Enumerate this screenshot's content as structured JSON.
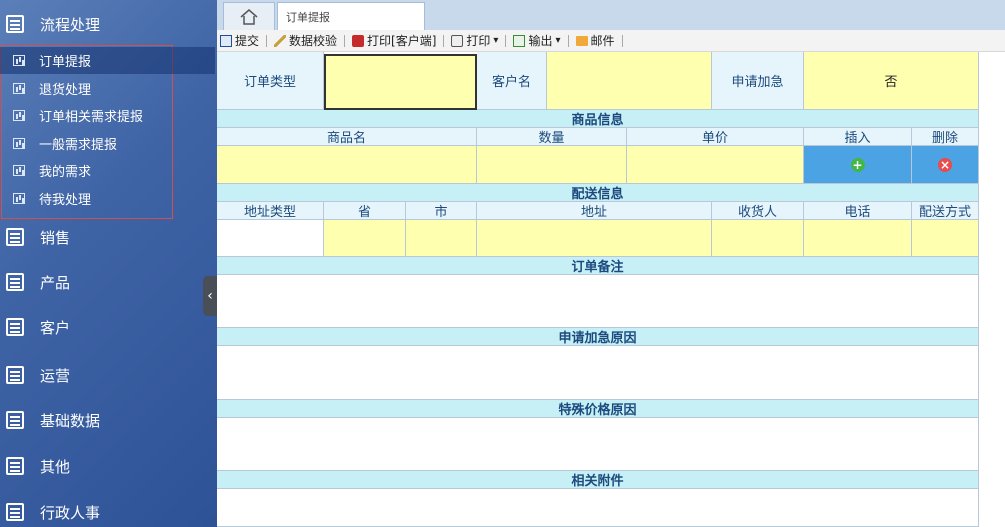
{
  "sidebar": {
    "categories": [
      {
        "label": "流程处理"
      },
      {
        "label": "销售"
      },
      {
        "label": "产品"
      },
      {
        "label": "客户"
      },
      {
        "label": "运营"
      },
      {
        "label": "基础数据"
      },
      {
        "label": "其他"
      },
      {
        "label": "行政人事"
      }
    ],
    "submenu": [
      {
        "label": "订单提报"
      },
      {
        "label": "退货处理"
      },
      {
        "label": "订单相关需求提报"
      },
      {
        "label": "一般需求提报"
      },
      {
        "label": "我的需求"
      },
      {
        "label": "待我处理"
      }
    ],
    "collapse_glyph": "‹"
  },
  "tabs": {
    "home_icon": "home-icon",
    "active_tab": "订单提报"
  },
  "toolbar": {
    "submit": "提交",
    "validate": "数据校验",
    "print_client": "打印[客户端]",
    "print": "打印",
    "export": "输出",
    "mail": "邮件",
    "dropdown_glyph": "▾"
  },
  "form": {
    "order_type_label": "订单类型",
    "order_type_value": "",
    "customer_label": "客户名",
    "customer_value": "",
    "urgent_label": "申请加急",
    "urgent_value": "否",
    "goods_section": "商品信息",
    "goods_headers": {
      "name": "商品名",
      "qty": "数量",
      "price": "单价",
      "insert": "插入",
      "delete": "删除"
    },
    "insert_glyph": "+",
    "delete_glyph": "×",
    "delivery_section": "配送信息",
    "delivery_headers": {
      "addr_type": "地址类型",
      "province": "省",
      "city": "市",
      "address": "地址",
      "receiver": "收货人",
      "phone": "电话",
      "method": "配送方式"
    },
    "remark_section": "订单备注",
    "urgent_reason_section": "申请加急原因",
    "special_price_section": "特殊价格原因",
    "attachment_section": "相关附件"
  },
  "colors": {
    "sidebar": "#3f64a6",
    "label_bg": "#e6f5fb",
    "input_bg": "#ffffb0",
    "section_bg": "#c6f0f6",
    "insert_btn": "#43b649",
    "delete_btn": "#e84c4c"
  }
}
